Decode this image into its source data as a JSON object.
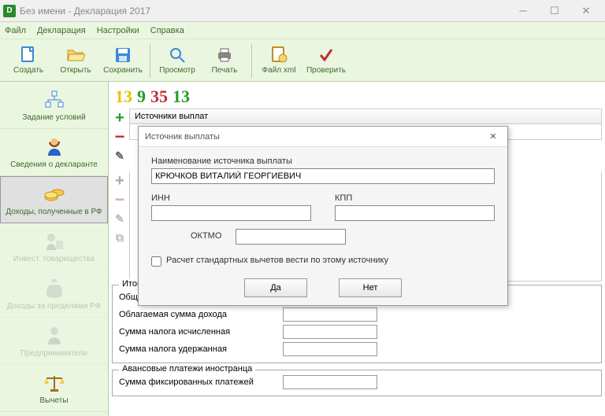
{
  "titlebar": {
    "icon_text": "D",
    "text": "Без имени - Декларация 2017"
  },
  "menu": {
    "file": "Файл",
    "decl": "Декларация",
    "settings": "Настройки",
    "help": "Справка"
  },
  "toolbar": {
    "create": "Создать",
    "open": "Открыть",
    "save": "Сохранить",
    "preview": "Просмотр",
    "print": "Печать",
    "filexml": "Файл xml",
    "check": "Проверить"
  },
  "nums": {
    "a": "13",
    "b": "9",
    "c": "35",
    "d": "13"
  },
  "sidebar": {
    "conditions": "Задание условий",
    "declarant": "Сведения о декларанте",
    "income_rf": "Доходы, полученные в РФ",
    "invest": "Инвест. товарищества",
    "income_abroad": "Доходы за пределами РФ",
    "entrepreneur": "Предприниматели",
    "deductions": "Вычеты"
  },
  "content": {
    "sources_header": "Источники выплат",
    "totals_legend": "Итоговые суммы по источнику выплат",
    "total_income": "Общая сумма дохода",
    "taxable_income": "Облагаемая сумма дохода",
    "tax_calc": "Сумма налога исчисленная",
    "tax_withheld": "Сумма налога удержанная",
    "advance_legend": "Авансовые платежи иностранца",
    "fixed_payments": "Сумма фиксированных платежей"
  },
  "dialog": {
    "title": "Источник выплаты",
    "name_label": "Наименование источника выплаты",
    "name_value": "КРЮЧКОВ ВИТАЛИЙ ГЕОРГИЕВИЧ",
    "inn": "ИНН",
    "kpp": "КПП",
    "oktmo": "ОКТМО",
    "checkbox": "Расчет стандартных вычетов вести по этому источнику",
    "yes": "Да",
    "no": "Нет"
  }
}
